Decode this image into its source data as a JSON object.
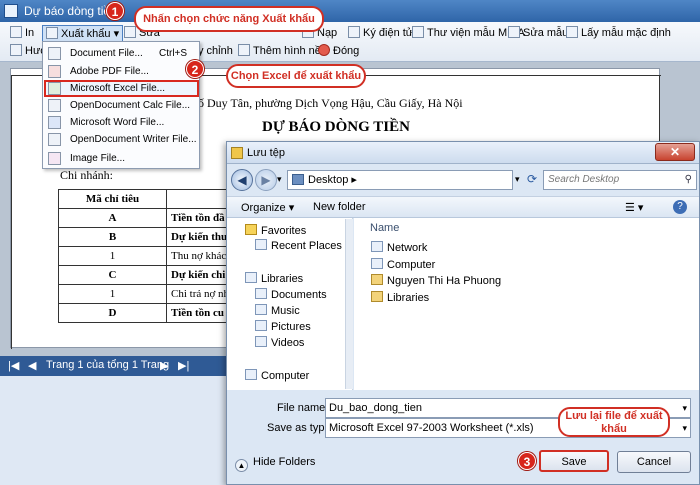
{
  "window": {
    "title": "Dự báo dòng tiền",
    "controls": [
      "–",
      "□",
      "✕"
    ]
  },
  "toolbar": {
    "row1": [
      {
        "label": "In",
        "icon": "printer-icon"
      },
      {
        "label": "Xuất khẩu",
        "icon": "export-icon",
        "active": true
      },
      {
        "label": "Sửa",
        "icon": "edit-icon"
      },
      {
        "label": "Nạp",
        "icon": "load-icon"
      },
      {
        "label": "Ký điện tử",
        "icon": "signature-icon"
      },
      {
        "label": "Thư viện mẫu MISA",
        "icon": "library-icon"
      },
      {
        "label": "Sửa mẫu",
        "icon": "edit-template-icon"
      },
      {
        "label": "Lấy mẫu mặc định",
        "icon": "default-template-icon"
      }
    ],
    "row2": [
      {
        "label": "Hướ",
        "icon": "help-icon"
      },
      {
        "label": "y chỉnh",
        "icon": "adjust-icon"
      },
      {
        "label": "Thêm hình nền",
        "icon": "background-icon"
      },
      {
        "label": "Đóng",
        "icon": "close-circle-icon"
      }
    ]
  },
  "export_menu": [
    {
      "label": "Document File...",
      "shortcut": "Ctrl+S",
      "icon": "save-doc-icon"
    },
    {
      "label": "Adobe PDF File...",
      "shortcut": "",
      "icon": "pdf-icon"
    },
    {
      "label": "Microsoft Excel File...",
      "shortcut": "",
      "icon": "excel-icon",
      "highlighted": true
    },
    {
      "label": "OpenDocument Calc File...",
      "shortcut": "",
      "icon": "calc-icon"
    },
    {
      "label": "Microsoft Word File...",
      "shortcut": "",
      "icon": "word-icon"
    },
    {
      "label": "OpenDocument Writer File...",
      "shortcut": "",
      "icon": "writer-icon"
    },
    {
      "label": "Image File...",
      "shortcut": "",
      "icon": "image-icon"
    }
  ],
  "callouts": {
    "step1": {
      "num": "1",
      "text": "Nhấn chọn chức năng Xuất khẩu"
    },
    "step2": {
      "num": "2",
      "text": "Chọn Excel để xuất khẩu"
    },
    "step3": {
      "num": "3",
      "text": "Lưu lại file để xuất khẩu"
    }
  },
  "report": {
    "address": "ố Duy Tân, phường Dịch Vọng Hậu, Cầu Giấy, Hà Nội",
    "title": "DỰ BÁO DÒNG TIỀN",
    "branch": "Chi nhánh:",
    "table": [
      {
        "code": "Mã chỉ tiêu",
        "name": "",
        "bold": true
      },
      {
        "code": "A",
        "name": "Tiền tồn đầ",
        "bold": true
      },
      {
        "code": "B",
        "name": "Dự kiến thu",
        "bold": true
      },
      {
        "code": "1",
        "name": "Thu nợ khác",
        "bold": false
      },
      {
        "code": "C",
        "name": "Dự kiến chi",
        "bold": true
      },
      {
        "code": "1",
        "name": "Chi trả nợ nh",
        "bold": false
      },
      {
        "code": "D",
        "name": "Tiền tồn cu",
        "bold": true
      }
    ]
  },
  "statusbar": {
    "page_text": "Trang 1 của tổng 1 Trang"
  },
  "save_dialog": {
    "title": "Lưu tệp",
    "path": "Desktop",
    "search_placeholder": "Search Desktop",
    "organize": "Organize ▾",
    "new_folder": "New folder",
    "nav": [
      {
        "label": "Favorites",
        "icon": "star-icon",
        "indent": 0
      },
      {
        "label": "Recent Places",
        "icon": "recent-places-icon",
        "indent": 1
      },
      {
        "label": "Libraries",
        "icon": "libraries-icon",
        "indent": 0
      },
      {
        "label": "Documents",
        "icon": "documents-icon",
        "indent": 1
      },
      {
        "label": "Music",
        "icon": "music-icon",
        "indent": 1
      },
      {
        "label": "Pictures",
        "icon": "pictures-icon",
        "indent": 1
      },
      {
        "label": "Videos",
        "icon": "videos-icon",
        "indent": 1
      },
      {
        "label": "Computer",
        "icon": "computer-icon",
        "indent": 0
      }
    ],
    "column_name": "Name",
    "items": [
      {
        "label": "Network",
        "icon": "network-icon"
      },
      {
        "label": "Computer",
        "icon": "computer-icon"
      },
      {
        "label": "Nguyen Thi Ha Phuong",
        "icon": "user-folder-icon"
      },
      {
        "label": "Libraries",
        "icon": "libraries-icon"
      }
    ],
    "file_name_label": "File name:",
    "file_name_value": "Du_bao_dong_tien",
    "save_type_label": "Save as type:",
    "save_type_value": "Microsoft Excel 97-2003 Worksheet (*.xls)",
    "hide_folders": "Hide Folders",
    "save_button": "Save",
    "cancel_button": "Cancel"
  }
}
